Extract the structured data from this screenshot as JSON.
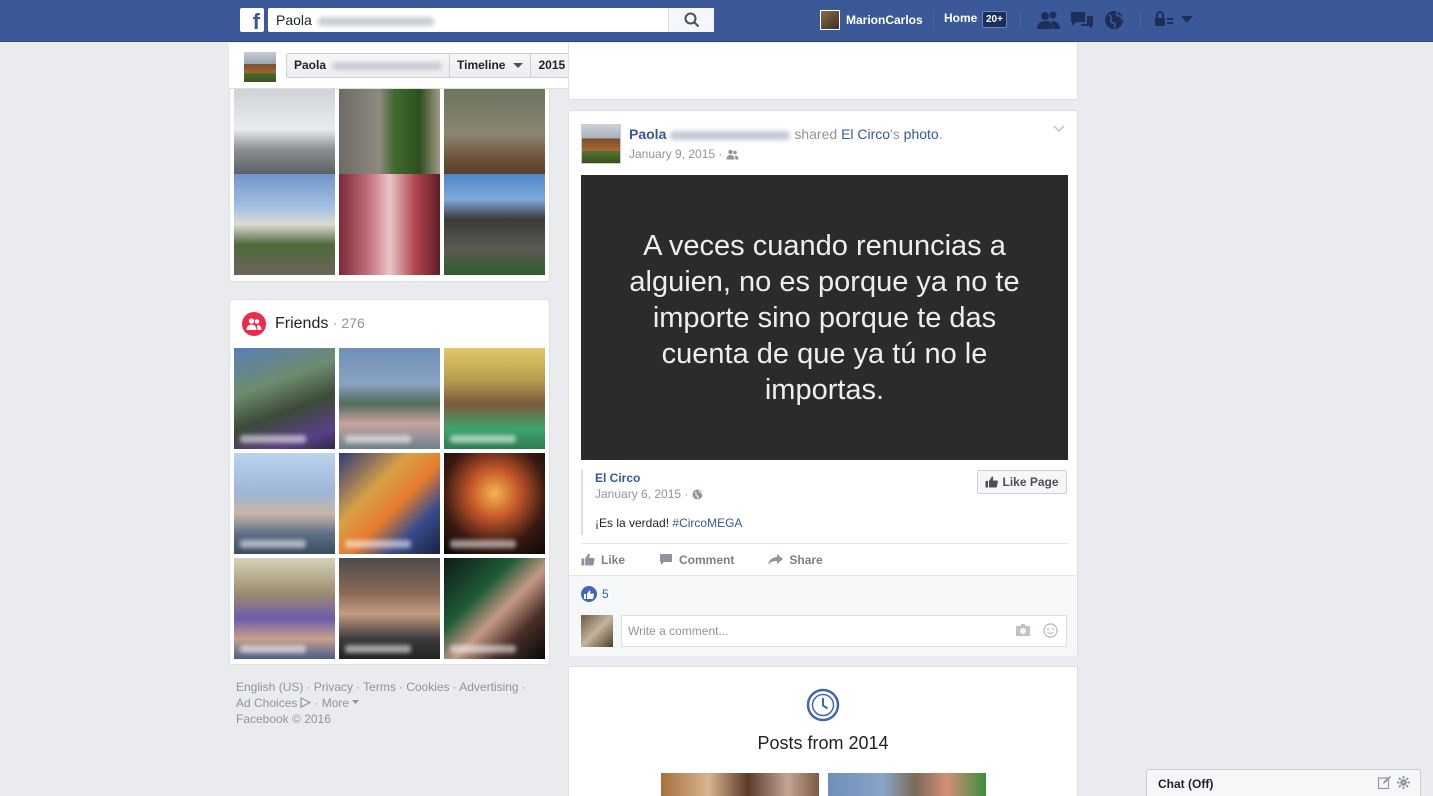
{
  "topbar": {
    "search_value": "Paola",
    "user_name": "MarionCarlos",
    "home_label": "Home",
    "home_badge": "20+"
  },
  "subheader": {
    "name": "Paola",
    "timeline_label": "Timeline",
    "year_label": "2015"
  },
  "friends": {
    "title": "Friends",
    "count": "276"
  },
  "footer": {
    "links": [
      "English (US)",
      "Privacy",
      "Terms",
      "Cookies",
      "Advertising",
      "Ad Choices",
      "More"
    ],
    "copyright": "Facebook © 2016"
  },
  "post": {
    "author": "Paola",
    "shared_text": "shared",
    "page_name": "El Circo",
    "possessive": "'s",
    "photo_link": "photo",
    "date": "January 9, 2015",
    "quote": "A veces cuando renuncias a alguien, no es porque ya no te importe sino porque te das cuenta de que ya tú no le importas.",
    "shared_page": "El Circo",
    "shared_date": "January 6, 2015",
    "shared_caption_prefix": "¡Es la verdad!",
    "shared_hashtag": "#CircoMEGA",
    "like_page_label": "Like Page",
    "actions": {
      "like": "Like",
      "comment": "Comment",
      "share": "Share"
    },
    "like_count": "5",
    "comment_placeholder": "Write a comment..."
  },
  "posts_from": {
    "title": "Posts from 2014"
  },
  "chat": {
    "label": "Chat (Off)"
  },
  "colors": {
    "brand": "#3b5998",
    "link": "#365899",
    "friends_accent": "#f02849"
  }
}
